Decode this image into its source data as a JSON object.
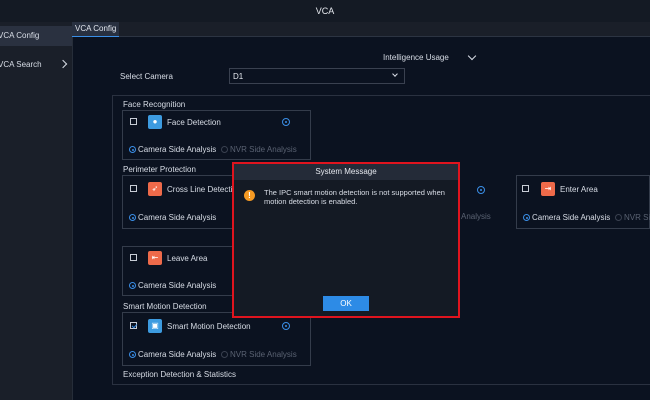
{
  "window": {
    "title": "VCA"
  },
  "sidebar": {
    "items": [
      {
        "label": "VCA Config"
      },
      {
        "label": "VCA Search"
      }
    ]
  },
  "tabs": [
    {
      "label": "VCA Config"
    }
  ],
  "intelligence_usage": {
    "label": "Intelligence Usage"
  },
  "select_camera": {
    "label": "Select Camera",
    "value": "D1"
  },
  "sections": {
    "face_recognition": "Face Recognition",
    "perimeter_protection": "Perimeter Protection",
    "smart_motion_detection": "Smart Motion Detection",
    "exception_detection": "Exception Detection & Statistics"
  },
  "features": {
    "face_detection": {
      "label": "Face Detection",
      "checked": false
    },
    "cross_line_detection": {
      "label": "Cross Line Detection",
      "checked": false
    },
    "enter_area": {
      "label": "Enter Area",
      "checked": false
    },
    "leave_area": {
      "label": "Leave Area",
      "checked": false
    },
    "smart_motion": {
      "label": "Smart Motion Detection",
      "checked": true
    }
  },
  "analysis": {
    "camera_side": "Camera Side Analysis",
    "nvr_side": "NVR Side Analysis",
    "nvr_side_partial": "NVR Side",
    "analysis_partial": "Analysis"
  },
  "dialog": {
    "title": "System Message",
    "message": "The IPC smart motion detection is not supported when motion detection is enabled.",
    "ok_label": "OK"
  },
  "colors": {
    "accent": "#3a8ee6",
    "alert_border": "#e0141e",
    "warning": "#f59a23",
    "feature_blue": "#3d9be0",
    "feature_orange": "#ee6a4a"
  }
}
